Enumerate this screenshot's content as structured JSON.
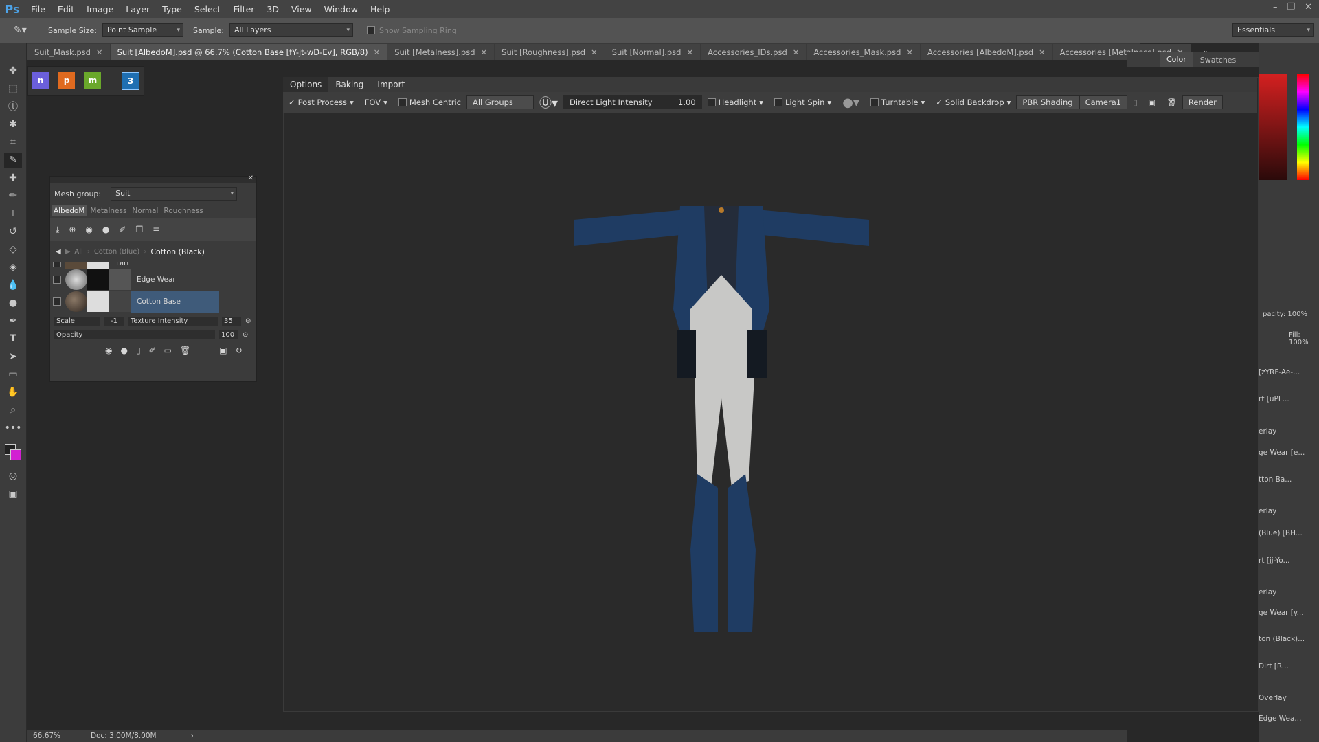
{
  "app": {
    "logo": "Ps"
  },
  "menu": [
    "File",
    "Edit",
    "Image",
    "Layer",
    "Type",
    "Select",
    "Filter",
    "3D",
    "View",
    "Window",
    "Help"
  ],
  "options_bar": {
    "sample_size_label": "Sample Size:",
    "sample_size_value": "Point Sample",
    "sample_label": "Sample:",
    "sample_value": "All Layers",
    "show_sampling_ring": "Show Sampling Ring",
    "workspace": "Essentials"
  },
  "doc_tabs": [
    {
      "label": "Suit_Mask.psd",
      "active": false
    },
    {
      "label": "Suit [AlbedoM].psd @ 66.7% (Cotton Base [fY-jt-wD-Ev], RGB/8)",
      "active": true
    },
    {
      "label": "Suit [Metalness].psd",
      "active": false
    },
    {
      "label": "Suit [Roughness].psd",
      "active": false
    },
    {
      "label": "Suit [Normal].psd",
      "active": false
    },
    {
      "label": "Accessories_IDs.psd",
      "active": false
    },
    {
      "label": "Accessories_Mask.psd",
      "active": false
    },
    {
      "label": "Accessories [AlbedoM].psd",
      "active": false
    },
    {
      "label": "Accessories [Metalness].psd",
      "active": false
    }
  ],
  "plugin_icons": [
    "n",
    "p",
    "m",
    "3"
  ],
  "viewer": {
    "tabs": [
      "Options",
      "Baking",
      "Import"
    ],
    "post_process": "Post Process",
    "fov": "FOV",
    "mesh_centric": "Mesh Centric",
    "groups": "All Groups",
    "light_field": "Direct Light Intensity",
    "light_value": "1.00",
    "headlight": "Headlight",
    "light_spin": "Light Spin",
    "turntable": "Turntable",
    "solid_backdrop": "Solid Backdrop",
    "shading": "PBR Shading",
    "camera": "Camera1",
    "render": "Render"
  },
  "layer_panel": {
    "mesh_group_label": "Mesh group:",
    "mesh_group_value": "Suit",
    "channel_tabs": [
      "AlbedoM",
      "Metalness",
      "Normal",
      "Roughness"
    ],
    "breadcrumb": [
      "All",
      "Cotton (Blue)",
      "Cotton (Black)"
    ],
    "layers": [
      {
        "name": "Dirt",
        "selected": false
      },
      {
        "name": "Edge Wear",
        "selected": false
      },
      {
        "name": "Cotton Base",
        "selected": true
      }
    ],
    "scale_label": "Scale",
    "scale_value": "-1",
    "texture_intensity_label": "Texture Intensity",
    "texture_intensity_value": "35",
    "opacity_label": "Opacity",
    "opacity_value": "100"
  },
  "right_panel": {
    "tabs": [
      "Color",
      "Swatches"
    ],
    "opacity_label": "pacity:",
    "opacity_value": "100%",
    "fill_label": "Fill:",
    "fill_value": "100%",
    "layers": [
      "[zYRF-Ae-...",
      "rt [uPL...",
      "erlay",
      "ge Wear [e...",
      "tton Ba...",
      "erlay",
      "(Blue) [BH...",
      "rt [jj-Yo...",
      "erlay",
      "ge Wear [y...",
      "ton (Black)...",
      "Dirt [R...",
      "Overlay",
      "Edge Wea..."
    ]
  },
  "status_bar": {
    "zoom": "66.67%",
    "doc": "Doc: 3.00M/8.00M"
  },
  "colors": {
    "accent_selected": "#3f5b7a",
    "figure_blue": "#1f3c63",
    "figure_white": "#c8c8c6"
  }
}
